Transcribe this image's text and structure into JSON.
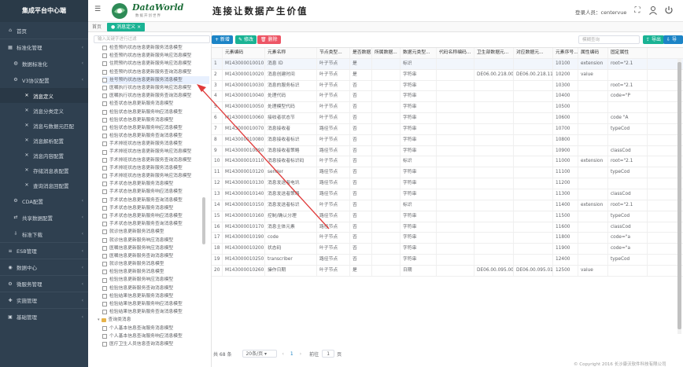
{
  "sidebar": {
    "brand": "集成平台中心端",
    "items": [
      {
        "label": "首页",
        "icon": "home-icon",
        "level": 0,
        "expandable": false
      },
      {
        "label": "标准化管理",
        "icon": "grid-icon",
        "level": 0,
        "expandable": true
      },
      {
        "label": "数据标准化",
        "icon": "data-icon",
        "level": 1,
        "expandable": true
      },
      {
        "label": "V3协议配置",
        "icon": "gear-icon",
        "level": 1,
        "expandable": true
      },
      {
        "label": "消息定义",
        "icon": "cross-icon",
        "level": 2,
        "expandable": false,
        "active": true
      },
      {
        "label": "消息分类定义",
        "icon": "cross-icon",
        "level": 2,
        "expandable": false
      },
      {
        "label": "消息与数据元匹配",
        "icon": "cross-icon",
        "level": 2,
        "expandable": false
      },
      {
        "label": "消息解析配置",
        "icon": "cross-icon",
        "level": 2,
        "expandable": false
      },
      {
        "label": "消息内容配置",
        "icon": "cross-icon",
        "level": 2,
        "expandable": false
      },
      {
        "label": "存储消息表配置",
        "icon": "cross-icon",
        "level": 2,
        "expandable": false
      },
      {
        "label": "查询消息回配置",
        "icon": "cross-icon",
        "level": 2,
        "expandable": false
      },
      {
        "label": "CDA配置",
        "icon": "gear-icon",
        "level": 1,
        "expandable": true
      },
      {
        "label": "共享数据配置",
        "icon": "share-icon",
        "level": 1,
        "expandable": true
      },
      {
        "label": "标准下载",
        "icon": "download-icon",
        "level": 1,
        "expandable": true
      },
      {
        "label": "ESB管理",
        "icon": "esb-icon",
        "level": 0,
        "expandable": true
      },
      {
        "label": "数据中心",
        "icon": "database-icon",
        "level": 0,
        "expandable": true
      },
      {
        "label": "微服务管理",
        "icon": "service-icon",
        "level": 0,
        "expandable": true
      },
      {
        "label": "实施管理",
        "icon": "tool-icon",
        "level": 0,
        "expandable": true
      },
      {
        "label": "基础管理",
        "icon": "base-icon",
        "level": 0,
        "expandable": true
      }
    ]
  },
  "header": {
    "logo_text": "DataWorld",
    "logo_sub": "数据开创世界",
    "slogan": "连接让数据产生价值",
    "user_label": "登录人员：",
    "user_name": "centervue"
  },
  "tabs": [
    {
      "label": "首页",
      "active": false
    },
    {
      "label": "消息定义",
      "active": true
    }
  ],
  "tree": {
    "search_placeholder": "输入关键字进行过滤",
    "nodes": [
      {
        "label": "检查预约状态信息更新服务消息模型",
        "type": "file"
      },
      {
        "label": "检查预约状态信息更新服务响应消息模型",
        "type": "file"
      },
      {
        "label": "住院预约状态信息更新服务响应消息模型",
        "type": "file"
      },
      {
        "label": "检查预约状态信息更新服务查询消息模型",
        "type": "file"
      },
      {
        "label": "挂号预约状态信息更新服务消息模型",
        "type": "file",
        "selected": true
      },
      {
        "label": "医嘱执行状态信息更新服务响应消息模型",
        "type": "file"
      },
      {
        "label": "医嘱执行状态信息更新服务查询消息模型",
        "type": "file"
      },
      {
        "label": "检查状态信息更新服务消息模型",
        "type": "file"
      },
      {
        "label": "检验状态信息更新服务响应消息模型",
        "type": "file"
      },
      {
        "label": "检验状态信息更新服务消息模型",
        "type": "file"
      },
      {
        "label": "检验状态信息更新服务响应消息模型",
        "type": "file"
      },
      {
        "label": "检验状态信息更新服务查询消息模型",
        "type": "file"
      },
      {
        "label": "手术排班状态信息更新服务消息模型",
        "type": "file"
      },
      {
        "label": "手术排班状态信息更新服务响应消息模型",
        "type": "file"
      },
      {
        "label": "手术排班状态信息更新服务查询消息模型",
        "type": "file"
      },
      {
        "label": "手术排班状态信息更新服务消息模型",
        "type": "file"
      },
      {
        "label": "手术排班状态信息更新服务响应消息模型",
        "type": "file"
      },
      {
        "label": "手术状态信息更新服务消息模型",
        "type": "file"
      },
      {
        "label": "手术状态信息更新服务响应消息模型",
        "type": "file"
      },
      {
        "label": "手术状态信息更新服务查询消息模型",
        "type": "file"
      },
      {
        "label": "手术状态信息更新服务消息模型",
        "type": "file"
      },
      {
        "label": "手术状态信息更新服务响应消息模型",
        "type": "file"
      },
      {
        "label": "手术状态信息更新服务查询消息模型",
        "type": "file"
      },
      {
        "label": "就诊信息更新服务消息模型",
        "type": "file"
      },
      {
        "label": "就诊信息更新服务响应消息模型",
        "type": "file"
      },
      {
        "label": "医嘱信息更新服务响应消息模型",
        "type": "file"
      },
      {
        "label": "医嘱信息更新服务查询消息模型",
        "type": "file"
      },
      {
        "label": "就诊信息更新服务消息模型",
        "type": "file"
      },
      {
        "label": "检验信息更新服务消息模型",
        "type": "file"
      },
      {
        "label": "检验信息更新服务响应消息模型",
        "type": "file"
      },
      {
        "label": "检验信息更新服务查询消息模型",
        "type": "file"
      },
      {
        "label": "检验结果信息更新服务消息模型",
        "type": "file"
      },
      {
        "label": "检验结果信息更新服务响应消息模型",
        "type": "file"
      },
      {
        "label": "检验结果信息更新服务查询消息模型",
        "type": "file"
      },
      {
        "label": "查询类消息",
        "type": "folder"
      },
      {
        "label": "个人基本信息查询服务消息模型",
        "type": "file"
      },
      {
        "label": "个人基本信息查询服务响应消息模型",
        "type": "file"
      },
      {
        "label": "医疗卫生人员信息查询消息模型",
        "type": "file"
      }
    ]
  },
  "toolbar": {
    "add_label": "+ 新增",
    "edit_label": "修改",
    "delete_label": "删除",
    "search_placeholder": "模糊查询",
    "export_label": "导出",
    "import_label": "导入"
  },
  "grid": {
    "columns": [
      "",
      "元素编码",
      "元素名称",
      "节点类型...",
      "是否数据...",
      "所属数据...",
      "数据元类型...",
      "代码名称编码...",
      "卫生部数据元...",
      "对应数据元...",
      "元素序号...",
      "属性编码",
      "固定属性"
    ],
    "rows": [
      [
        "1",
        "M143000010010",
        "消息 ID",
        "叶子节点",
        "是",
        "",
        "标识",
        "",
        "",
        "",
        "10100",
        "extension",
        "root=\"2.1"
      ],
      [
        "2",
        "M143000010020",
        "消息创建时间",
        "叶子节点",
        "是",
        "",
        "字符串",
        "",
        "DE06.00.218.00",
        "DE06.00.218.11",
        "10200",
        "value",
        ""
      ],
      [
        "3",
        "M143000010030",
        "消息的服务标识",
        "叶子节点",
        "否",
        "",
        "字符串",
        "",
        "",
        "",
        "10300",
        "",
        "root=\"2.1"
      ],
      [
        "4",
        "M143000010040",
        "处理代码",
        "叶子节点",
        "否",
        "",
        "字符串",
        "",
        "",
        "",
        "10400",
        "",
        "code=\"P"
      ],
      [
        "5",
        "M143000010050",
        "处理模型代码",
        "叶子节点",
        "否",
        "",
        "字符串",
        "",
        "",
        "",
        "10500",
        "",
        ""
      ],
      [
        "6",
        "M143000010060",
        "接收者状态节",
        "叶子节点",
        "否",
        "",
        "字符串",
        "",
        "",
        "",
        "10600",
        "",
        "code \"A"
      ],
      [
        "7",
        "M143000010070",
        "消息接收者",
        "路径节点",
        "否",
        "",
        "字符串",
        "",
        "",
        "",
        "10700",
        "",
        "typeCod"
      ],
      [
        "8",
        "M143000010080",
        "消息接收者标识",
        "叶子节点",
        "否",
        "",
        "字符串",
        "",
        "",
        "",
        "10800",
        "",
        ""
      ],
      [
        "9",
        "M143000010090",
        "消息接收者策略",
        "路径节点",
        "否",
        "",
        "字符串",
        "",
        "",
        "",
        "10900",
        "",
        "classCod"
      ],
      [
        "10",
        "M143000010110",
        "消息接收者标识码",
        "叶子节点",
        "否",
        "",
        "标识",
        "",
        "",
        "",
        "11000",
        "extension",
        "root=\"2.1"
      ],
      [
        "11",
        "M143000010120",
        "sender",
        "路径节点",
        "否",
        "",
        "字符串",
        "",
        "",
        "",
        "11100",
        "",
        "typeCod"
      ],
      [
        "12",
        "M143000010130",
        "消息发送者电讯",
        "路径节点",
        "否",
        "",
        "字符串",
        "",
        "",
        "",
        "11200",
        "",
        ""
      ],
      [
        "13",
        "M143000010140",
        "消息发送者策略",
        "路径节点",
        "否",
        "",
        "字符串",
        "",
        "",
        "",
        "11300",
        "",
        "classCod"
      ],
      [
        "14",
        "M143000010150",
        "消息发送者标识",
        "叶子节点",
        "否",
        "",
        "标识",
        "",
        "",
        "",
        "11400",
        "extension",
        "root=\"2.1"
      ],
      [
        "15",
        "M143000010160",
        "控制/确认分理",
        "路径节点",
        "否",
        "",
        "字符串",
        "",
        "",
        "",
        "11500",
        "",
        "typeCod"
      ],
      [
        "16",
        "M143000010170",
        "消息主体元素",
        "路径节点",
        "否",
        "",
        "字符串",
        "",
        "",
        "",
        "11600",
        "",
        "classCod"
      ],
      [
        "17",
        "M143000010190",
        "code",
        "叶子节点",
        "否",
        "",
        "字符串",
        "",
        "",
        "",
        "11800",
        "",
        "code=\"a"
      ],
      [
        "18",
        "M143000010200",
        "状态码",
        "叶子节点",
        "否",
        "",
        "字符串",
        "",
        "",
        "",
        "11900",
        "",
        "code=\"a"
      ],
      [
        "19",
        "M143000010250",
        "transcriber",
        "路径节点",
        "否",
        "",
        "字符串",
        "",
        "",
        "",
        "12400",
        "",
        "typeCod"
      ],
      [
        "20",
        "M143000010260",
        "操作日期",
        "叶子节点",
        "是",
        "",
        "日期",
        "",
        "DE06.00.095.00",
        "DE06.00.095.01",
        "12500",
        "value",
        ""
      ]
    ]
  },
  "pager": {
    "total": "共 68 条",
    "page_size": "20条/页",
    "goto_label": "前往",
    "current_page": "1",
    "page_unit": "页"
  },
  "copyright": "© Copyright 2016 长沙康沃软件科技有限公司",
  "colors": {
    "sidebar_bg": "#2f4050",
    "accent_green": "#1ab394",
    "accent_blue": "#1c84c6",
    "danger_red": "#ed5565",
    "annotation_red": "#e03a3a"
  }
}
